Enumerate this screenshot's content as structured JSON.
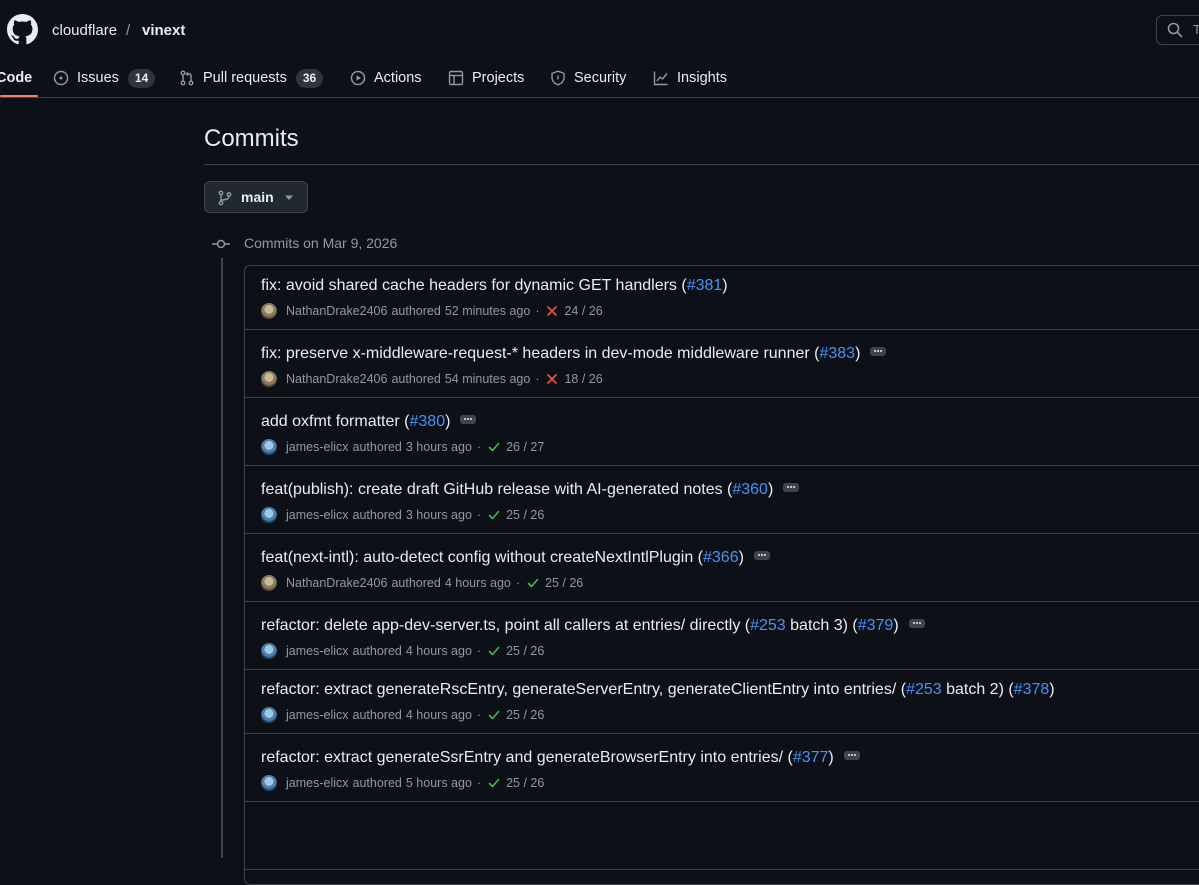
{
  "header": {
    "owner": "cloudflare",
    "separator": "/",
    "repo": "vinext",
    "search_placeholder": "T"
  },
  "tabs": [
    {
      "label": "Code",
      "icon": "code-icon",
      "active": true
    },
    {
      "label": "Issues",
      "icon": "issue-opened-icon",
      "count": "14"
    },
    {
      "label": "Pull requests",
      "icon": "git-pull-request-icon",
      "count": "36"
    },
    {
      "label": "Actions",
      "icon": "play-icon"
    },
    {
      "label": "Projects",
      "icon": "table-icon"
    },
    {
      "label": "Security",
      "icon": "shield-icon"
    },
    {
      "label": "Insights",
      "icon": "graph-icon"
    }
  ],
  "page": {
    "title": "Commits",
    "branch": "main",
    "group_heading": "Commits on Mar 9, 2026"
  },
  "colors": {
    "background": "#0d1117",
    "accent_link": "#4493f8",
    "failure": "#f85149",
    "success": "#3fb950",
    "tab_underline": "#f78166"
  },
  "commits": [
    {
      "message": "fix: avoid shared cache headers for dynamic GET handlers (",
      "pr1": "#381",
      "mid": "",
      "pr2": "",
      "end": ")",
      "has_ellipsis": false,
      "author": "NathanDrake2406",
      "verb": "authored",
      "time": "52 minutes ago",
      "sep": "·",
      "status": "failure",
      "checks": "24 / 26"
    },
    {
      "message": "fix: preserve x-middleware-request-* headers in dev-mode middleware runner (",
      "pr1": "#383",
      "mid": "",
      "pr2": "",
      "end": ")",
      "has_ellipsis": true,
      "author": "NathanDrake2406",
      "verb": "authored",
      "time": "54 minutes ago",
      "sep": "·",
      "status": "failure",
      "checks": "18 / 26"
    },
    {
      "message": "add oxfmt formatter (",
      "pr1": "#380",
      "mid": "",
      "pr2": "",
      "end": ")",
      "has_ellipsis": true,
      "author": "james-elicx",
      "verb": "authored",
      "time": "3 hours ago",
      "sep": "·",
      "status": "success",
      "checks": "26 / 27"
    },
    {
      "message": "feat(publish): create draft GitHub release with AI-generated notes (",
      "pr1": "#360",
      "mid": "",
      "pr2": "",
      "end": ")",
      "has_ellipsis": true,
      "author": "james-elicx",
      "verb": "authored",
      "time": "3 hours ago",
      "sep": "·",
      "status": "success",
      "checks": "25 / 26"
    },
    {
      "message": "feat(next-intl): auto-detect config without createNextIntlPlugin (",
      "pr1": "#366",
      "mid": "",
      "pr2": "",
      "end": ")",
      "has_ellipsis": true,
      "author": "NathanDrake2406",
      "verb": "authored",
      "time": "4 hours ago",
      "sep": "·",
      "status": "success",
      "checks": "25 / 26"
    },
    {
      "message": "refactor: delete app-dev-server.ts, point all callers at entries/ directly (",
      "pr1": "#253",
      "mid": " batch 3) (",
      "pr2": "#379",
      "end": ")",
      "has_ellipsis": true,
      "author": "james-elicx",
      "verb": "authored",
      "time": "4 hours ago",
      "sep": "·",
      "status": "success",
      "checks": "25 / 26"
    },
    {
      "message": "refactor: extract generateRscEntry, generateServerEntry, generateClientEntry into entries/ (",
      "pr1": "#253",
      "mid": " batch 2) (",
      "pr2": "#378",
      "end": ")",
      "has_ellipsis": false,
      "author": "james-elicx",
      "verb": "authored",
      "time": "4 hours ago",
      "sep": "·",
      "status": "success",
      "checks": "25 / 26"
    },
    {
      "message": "refactor: extract generateSsrEntry and generateBrowserEntry into entries/ (",
      "pr1": "#377",
      "mid": "",
      "pr2": "",
      "end": ")",
      "has_ellipsis": true,
      "author": "james-elicx",
      "verb": "authored",
      "time": "5 hours ago",
      "sep": "·",
      "status": "success",
      "checks": "25 / 26"
    }
  ]
}
